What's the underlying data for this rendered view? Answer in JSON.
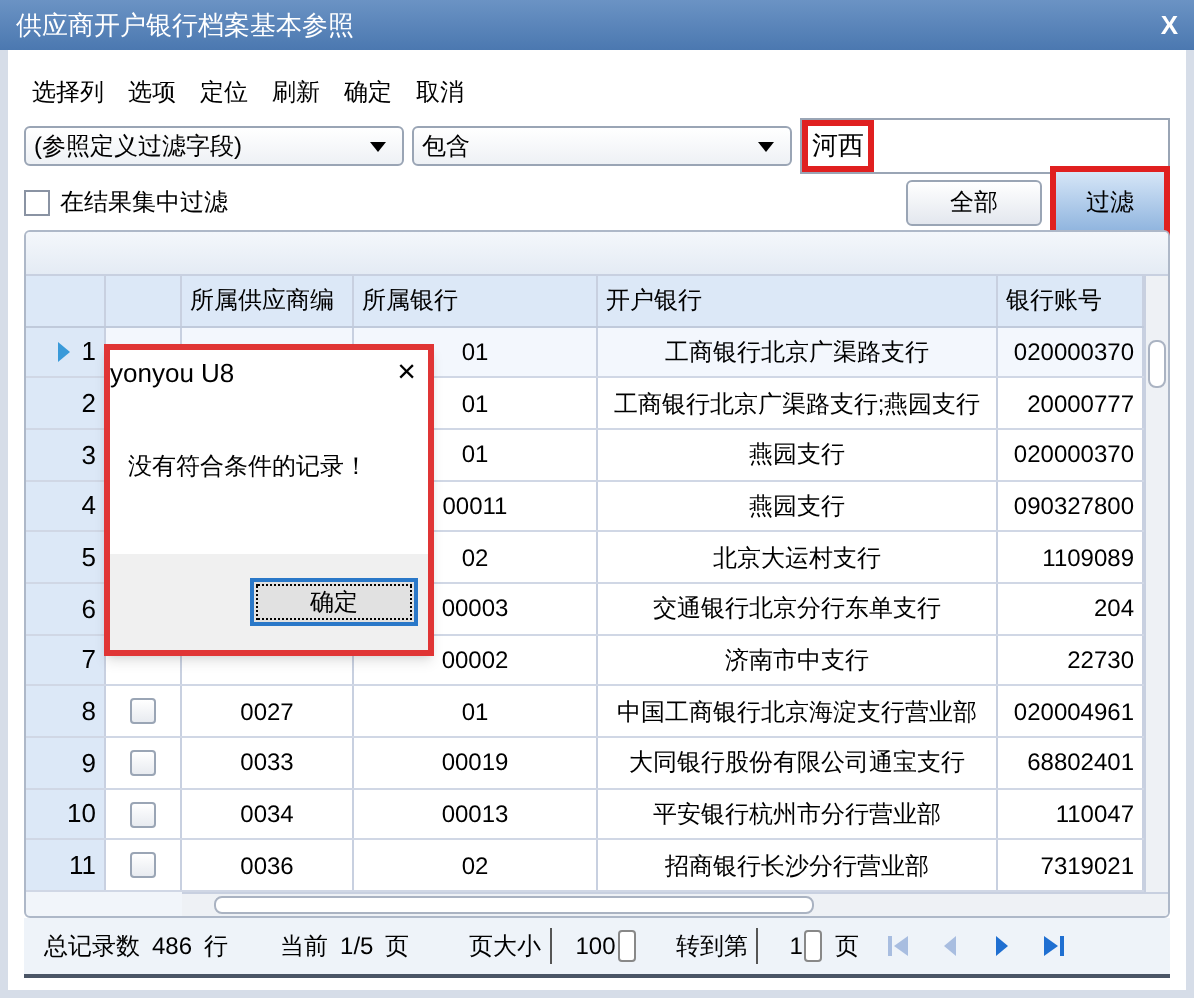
{
  "window": {
    "title": "供应商开户银行档案基本参照",
    "close": "X"
  },
  "menu": [
    "选择列",
    "选项",
    "定位",
    "刷新",
    "确定",
    "取消"
  ],
  "filter": {
    "field": "(参照定义过滤字段)",
    "operator": "包含",
    "value": "河西",
    "in_result_label": "在结果集中过滤",
    "in_result_checked": false,
    "all_button": "全部",
    "filter_button": "过滤"
  },
  "table": {
    "columns": [
      "所属供应商编",
      "所属银行",
      "开户银行",
      "银行账号"
    ],
    "rows": [
      {
        "num": "1",
        "selected": true,
        "bank": "01",
        "branch": "工商银行北京广渠路支行",
        "account": "020000370"
      },
      {
        "num": "2",
        "selected": false,
        "bank": "01",
        "branch": "工商银行北京广渠路支行;燕园支行",
        "account": "20000777"
      },
      {
        "num": "3",
        "selected": false,
        "bank": "01",
        "branch": "燕园支行",
        "account": "020000370"
      },
      {
        "num": "4",
        "selected": false,
        "bank": "00011",
        "branch": "燕园支行",
        "account": "090327800"
      },
      {
        "num": "5",
        "selected": false,
        "bank": "02",
        "branch": "北京大运村支行",
        "account": "1109089"
      },
      {
        "num": "6",
        "selected": false,
        "bank": "00003",
        "branch": "交通银行北京分行东单支行",
        "account": "204"
      },
      {
        "num": "7",
        "selected": false,
        "bank": "00002",
        "branch": "济南市中支行",
        "account": "22730"
      },
      {
        "num": "8",
        "selected": false,
        "checked": false,
        "code": "0027",
        "bank": "01",
        "branch": "中国工商银行北京海淀支行营业部",
        "account": "020004961"
      },
      {
        "num": "9",
        "selected": false,
        "checked": false,
        "code": "0033",
        "bank": "00019",
        "branch": "大同银行股份有限公司通宝支行",
        "account": "68802401"
      },
      {
        "num": "10",
        "selected": false,
        "checked": false,
        "code": "0034",
        "bank": "00013",
        "branch": "平安银行杭州市分行营业部",
        "account": "110047"
      },
      {
        "num": "11",
        "selected": false,
        "checked": false,
        "code": "0036",
        "bank": "02",
        "branch": "招商银行长沙分行营业部",
        "account": "7319021"
      }
    ]
  },
  "status_bar": {
    "total_label": "总记录数",
    "total": "486",
    "rows_unit": "行",
    "current_label": "当前",
    "page": "1/5",
    "page_unit": "页",
    "page_size_label": "页大小",
    "page_size": "100",
    "goto_label": "转到第",
    "goto_value": "1",
    "goto_unit": "页"
  },
  "dialog": {
    "title": "yonyou U8",
    "close": "×",
    "message": "没有符合条件的记录！",
    "ok": "确定"
  }
}
